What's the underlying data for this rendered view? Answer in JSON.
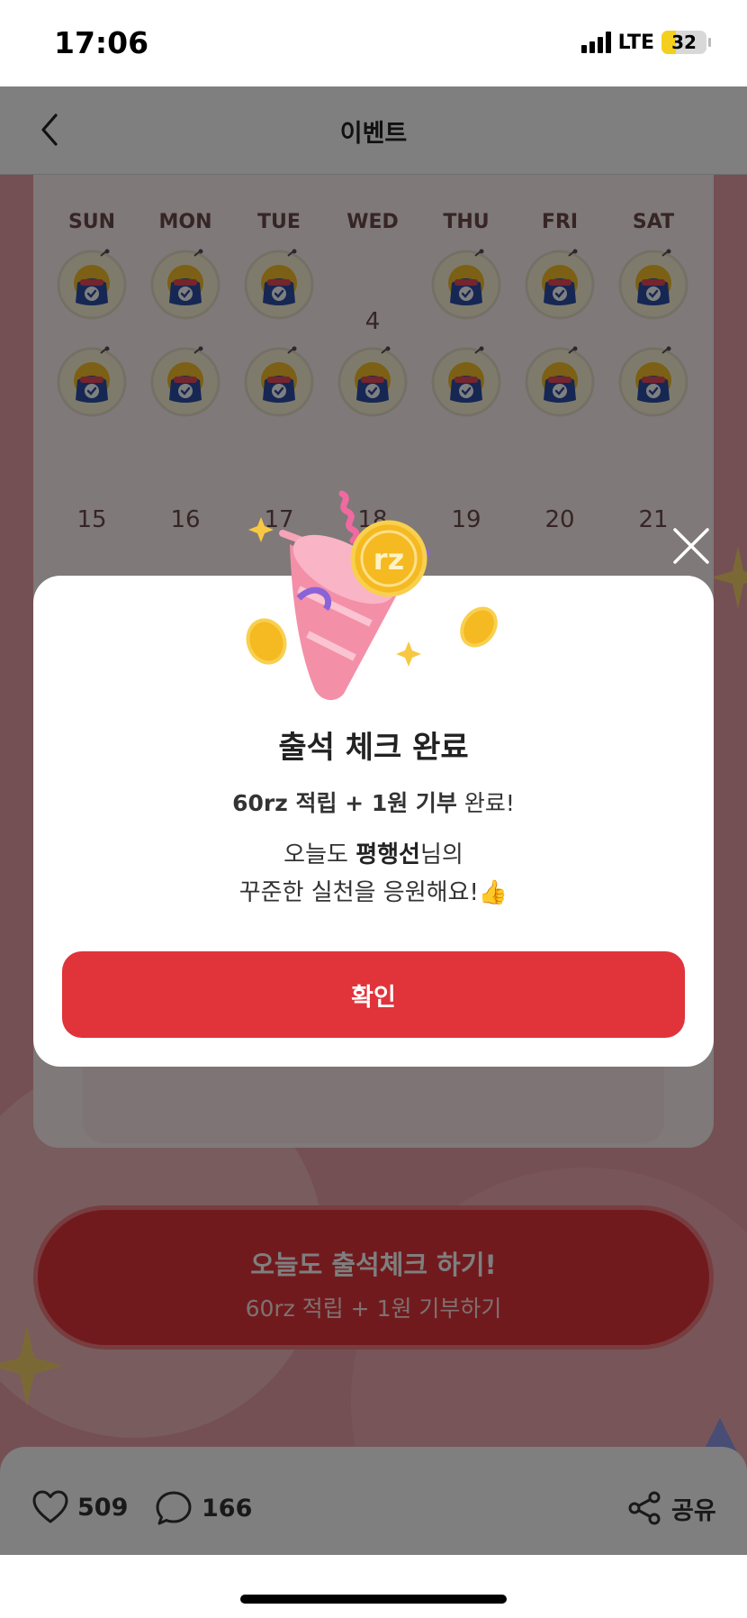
{
  "status_bar": {
    "time": "17:06",
    "network": "LTE",
    "battery": "32",
    "battery_level": 0.32
  },
  "nav": {
    "title": "이벤트",
    "back_icon": "chevron-left-icon"
  },
  "calendar": {
    "weekdays": [
      "SUN",
      "MON",
      "TUE",
      "WED",
      "THU",
      "FRI",
      "SAT"
    ],
    "week1_missed_day": "4",
    "week3_days": [
      "15",
      "16",
      "17",
      "18",
      "19",
      "20",
      "21"
    ]
  },
  "cta": {
    "title": "오늘도 출석체크 하기!",
    "subtitle": "60rz 적립 + 1원 기부하기"
  },
  "bottom_bar": {
    "likes": "509",
    "comments": "166",
    "share_label": "공유"
  },
  "modal": {
    "coin_label": "rz",
    "title": "출석 체크 완료",
    "reward_bold": "60rz 적립 + 1원 기부",
    "reward_rest": " 완료!",
    "msg_prefix": "오늘도 ",
    "user_name": "평행선",
    "msg_suffix": "님의",
    "msg_line2": "꾸준한 실천을 응원해요!",
    "msg_emoji": "👍",
    "confirm_label": "확인"
  },
  "colors": {
    "accent": "#e1333a",
    "background": "#e9a0a8",
    "coin": "#f5b921",
    "stamp_blue": "#2c4fa8"
  }
}
